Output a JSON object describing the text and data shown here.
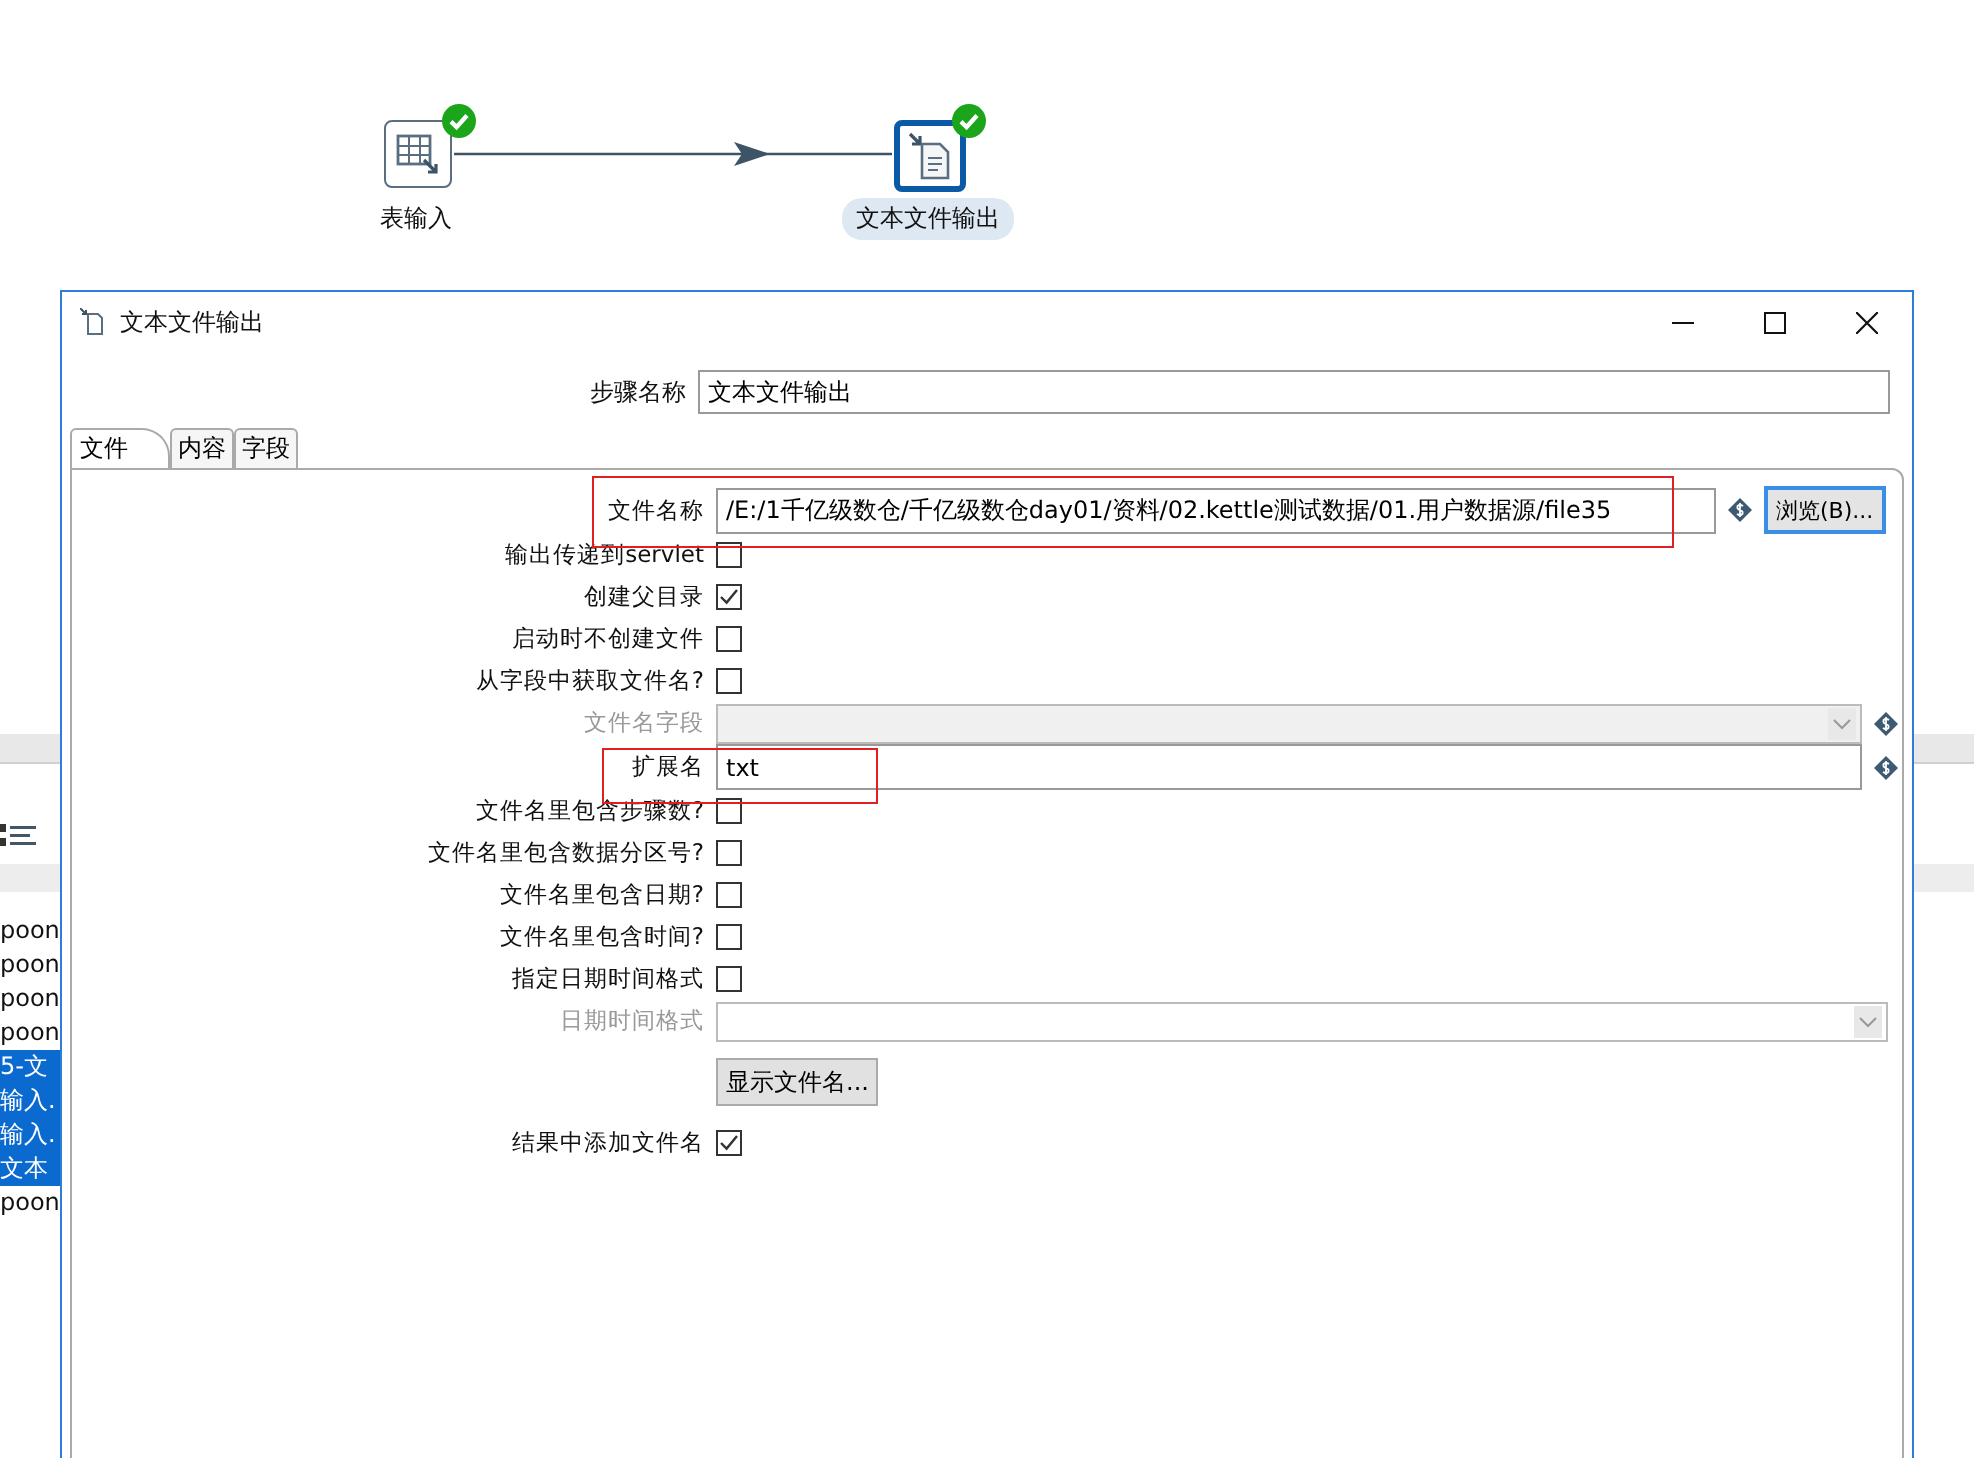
{
  "canvas": {
    "nodes": [
      {
        "label": "表输入",
        "kind": "table-input",
        "selected": false
      },
      {
        "label": "文本文件输出",
        "kind": "text-output",
        "selected": true
      }
    ]
  },
  "background_list": {
    "items": [
      {
        "text": "poon",
        "selected": false
      },
      {
        "text": "poon",
        "selected": false
      },
      {
        "text": "poon",
        "selected": false
      },
      {
        "text": "poon",
        "selected": false
      },
      {
        "text": "5-文",
        "selected": true
      },
      {
        "text": "输入.",
        "selected": true
      },
      {
        "text": "输入.",
        "selected": true
      },
      {
        "text": "文本",
        "selected": true
      },
      {
        "text": "poon",
        "selected": false
      }
    ]
  },
  "dialog": {
    "title": "文本文件输出",
    "step_name": {
      "label": "步骤名称",
      "value": "文本文件输出"
    },
    "tabs": [
      {
        "label": "文件",
        "selected": true
      },
      {
        "label": "内容",
        "selected": false
      },
      {
        "label": "字段",
        "selected": false
      }
    ],
    "fields": [
      {
        "kind": "text",
        "label": "文件名称",
        "value": "/E:/1千亿级数仓/千亿级数仓day01/资料/02.kettle测试数据/01.用户数据源/file35",
        "variable": true,
        "button": "浏览(B)..."
      },
      {
        "kind": "checkbox",
        "label": "输出传递到servlet",
        "checked": false
      },
      {
        "kind": "checkbox",
        "label": "创建父目录",
        "checked": true
      },
      {
        "kind": "checkbox",
        "label": "启动时不创建文件",
        "checked": false
      },
      {
        "kind": "checkbox",
        "label": "从字段中获取文件名?",
        "checked": false
      },
      {
        "kind": "combo",
        "label": "文件名字段",
        "disabled": true,
        "variable": true
      },
      {
        "kind": "text",
        "label": "扩展名",
        "value": "txt",
        "variable": true
      },
      {
        "kind": "checkbox",
        "label": "文件名里包含步骤数?",
        "checked": false
      },
      {
        "kind": "checkbox",
        "label": "文件名里包含数据分区号?",
        "checked": false
      },
      {
        "kind": "checkbox",
        "label": "文件名里包含日期?",
        "checked": false
      },
      {
        "kind": "checkbox",
        "label": "文件名里包含时间?",
        "checked": false
      },
      {
        "kind": "checkbox",
        "label": "指定日期时间格式",
        "checked": false
      },
      {
        "kind": "combo",
        "label": "日期时间格式",
        "disabled": true,
        "variable": false
      },
      {
        "kind": "button",
        "label": "显示文件名..."
      },
      {
        "kind": "checkbox",
        "label": "结果中添加文件名",
        "checked": true
      }
    ]
  }
}
